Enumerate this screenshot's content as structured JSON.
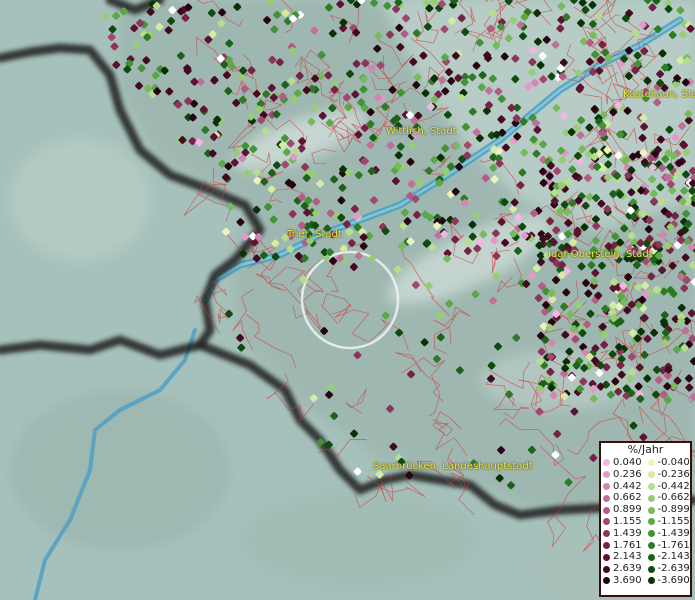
{
  "places": [
    {
      "name": "Wittlich, Stadt"
    },
    {
      "name": "Kastellaun, Sta"
    },
    {
      "name": "Trier, Stadt"
    },
    {
      "name": "Idar-Oberstein, Stadt"
    },
    {
      "name": "Saarbrücken, Landeshauptstadt"
    }
  ],
  "legend": {
    "title": "%/Jahr",
    "positive": [
      {
        "label": "0.040",
        "color": "#f3b6e2"
      },
      {
        "label": "0.236",
        "color": "#e29acb"
      },
      {
        "label": "0.442",
        "color": "#d385b3"
      },
      {
        "label": "0.662",
        "color": "#c26f9c"
      },
      {
        "label": "0.899",
        "color": "#b25c86"
      },
      {
        "label": "1.155",
        "color": "#a04870"
      },
      {
        "label": "1.439",
        "color": "#8c355b"
      },
      {
        "label": "1.761",
        "color": "#762246"
      },
      {
        "label": "2.143",
        "color": "#5c1331"
      },
      {
        "label": "2.639",
        "color": "#420a20"
      },
      {
        "label": "3.690",
        "color": "#260410"
      }
    ],
    "negative": [
      {
        "label": "-0.040",
        "color": "#eef3bb"
      },
      {
        "label": "-0.236",
        "color": "#d4eca3"
      },
      {
        "label": "-0.442",
        "color": "#b6de8c"
      },
      {
        "label": "-0.662",
        "color": "#97cd74"
      },
      {
        "label": "-0.899",
        "color": "#78bb5e"
      },
      {
        "label": "-1.155",
        "color": "#5ca849"
      },
      {
        "label": "-1.439",
        "color": "#429236"
      },
      {
        "label": "-1.761",
        "color": "#2e7a27"
      },
      {
        "label": "-2.143",
        "color": "#1d621a"
      },
      {
        "label": "-2.639",
        "color": "#0f4a0f"
      },
      {
        "label": "-3.690",
        "color": "#063206"
      }
    ]
  }
}
